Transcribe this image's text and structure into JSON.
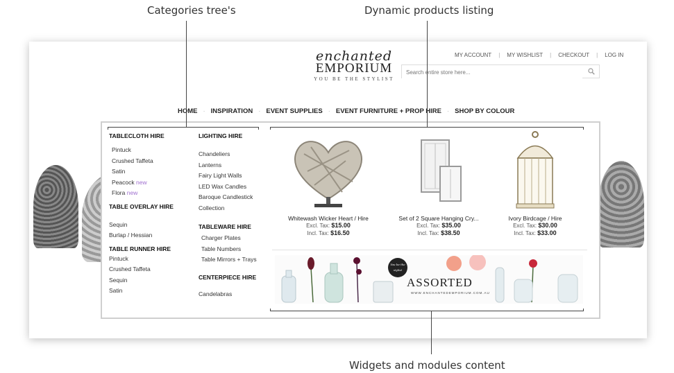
{
  "annotations": {
    "categories": "Categories tree's",
    "products": "Dynamic products listing",
    "widgets": "Widgets and modules content"
  },
  "logo": {
    "script": "enchanted",
    "main": "EMPORIUM",
    "tagline": "YOU BE THE STYLIST"
  },
  "toplinks": [
    "MY ACCOUNT",
    "MY WISHLIST",
    "CHECKOUT",
    "LOG IN"
  ],
  "search": {
    "placeholder": "Search entire store here..."
  },
  "nav": [
    "HOME",
    "INSPIRATION",
    "EVENT SUPPLIES",
    "EVENT FURNITURE + PROP HIRE",
    "SHOP BY COLOUR"
  ],
  "menu": {
    "tablecloth": {
      "heading": "TABLECLOTH HIRE",
      "items": [
        "Pintuck",
        "Crushed Taffeta",
        "Satin",
        "Peacock",
        "Flora"
      ],
      "new_label": "new"
    },
    "overlay": {
      "heading": "TABLE OVERLAY HIRE",
      "items": [
        "Sequin",
        "Burlap / Hessian"
      ]
    },
    "runner": {
      "heading": "TABLE RUNNER HIRE",
      "items": [
        "Pintuck",
        "Crushed Taffeta",
        "Sequin",
        "Satin"
      ]
    },
    "lighting": {
      "heading": "LIGHTING HIRE",
      "items": [
        "Chandeliers",
        "Lanterns",
        "Fairy Light Walls",
        "LED Wax Candles",
        "Baroque Candlestick",
        "Collection"
      ]
    },
    "tableware": {
      "heading": "TABLEWARE HIRE",
      "items": [
        "Charger Plates",
        "Table Numbers",
        "Table Mirrors + Trays"
      ]
    },
    "centerpiece": {
      "heading": "CENTERPIECE HIRE",
      "items": [
        "Candelabras"
      ]
    }
  },
  "products": [
    {
      "name": "Whitewash Wicker Heart / Hire",
      "excl_label": "Excl. Tax:",
      "excl": "$15.00",
      "incl_label": "Incl. Tax:",
      "incl": "$16.50"
    },
    {
      "name": "Set of 2 Square Hanging Cry...",
      "excl_label": "Excl. Tax:",
      "excl": "$35.00",
      "incl_label": "Incl. Tax:",
      "incl": "$38.50"
    },
    {
      "name": "Ivory Birdcage / Hire",
      "excl_label": "Excl. Tax:",
      "excl": "$30.00",
      "incl_label": "Incl. Tax:",
      "incl": "$33.00"
    }
  ],
  "banner": {
    "badge": "You be the stylist",
    "title": "ASSORTED",
    "url": "WWW.ENCHANTEDEMPORIUM.COM.AU"
  },
  "colors": {
    "accent_new": "#a070d0",
    "panel_border": "#cfcfcf"
  }
}
